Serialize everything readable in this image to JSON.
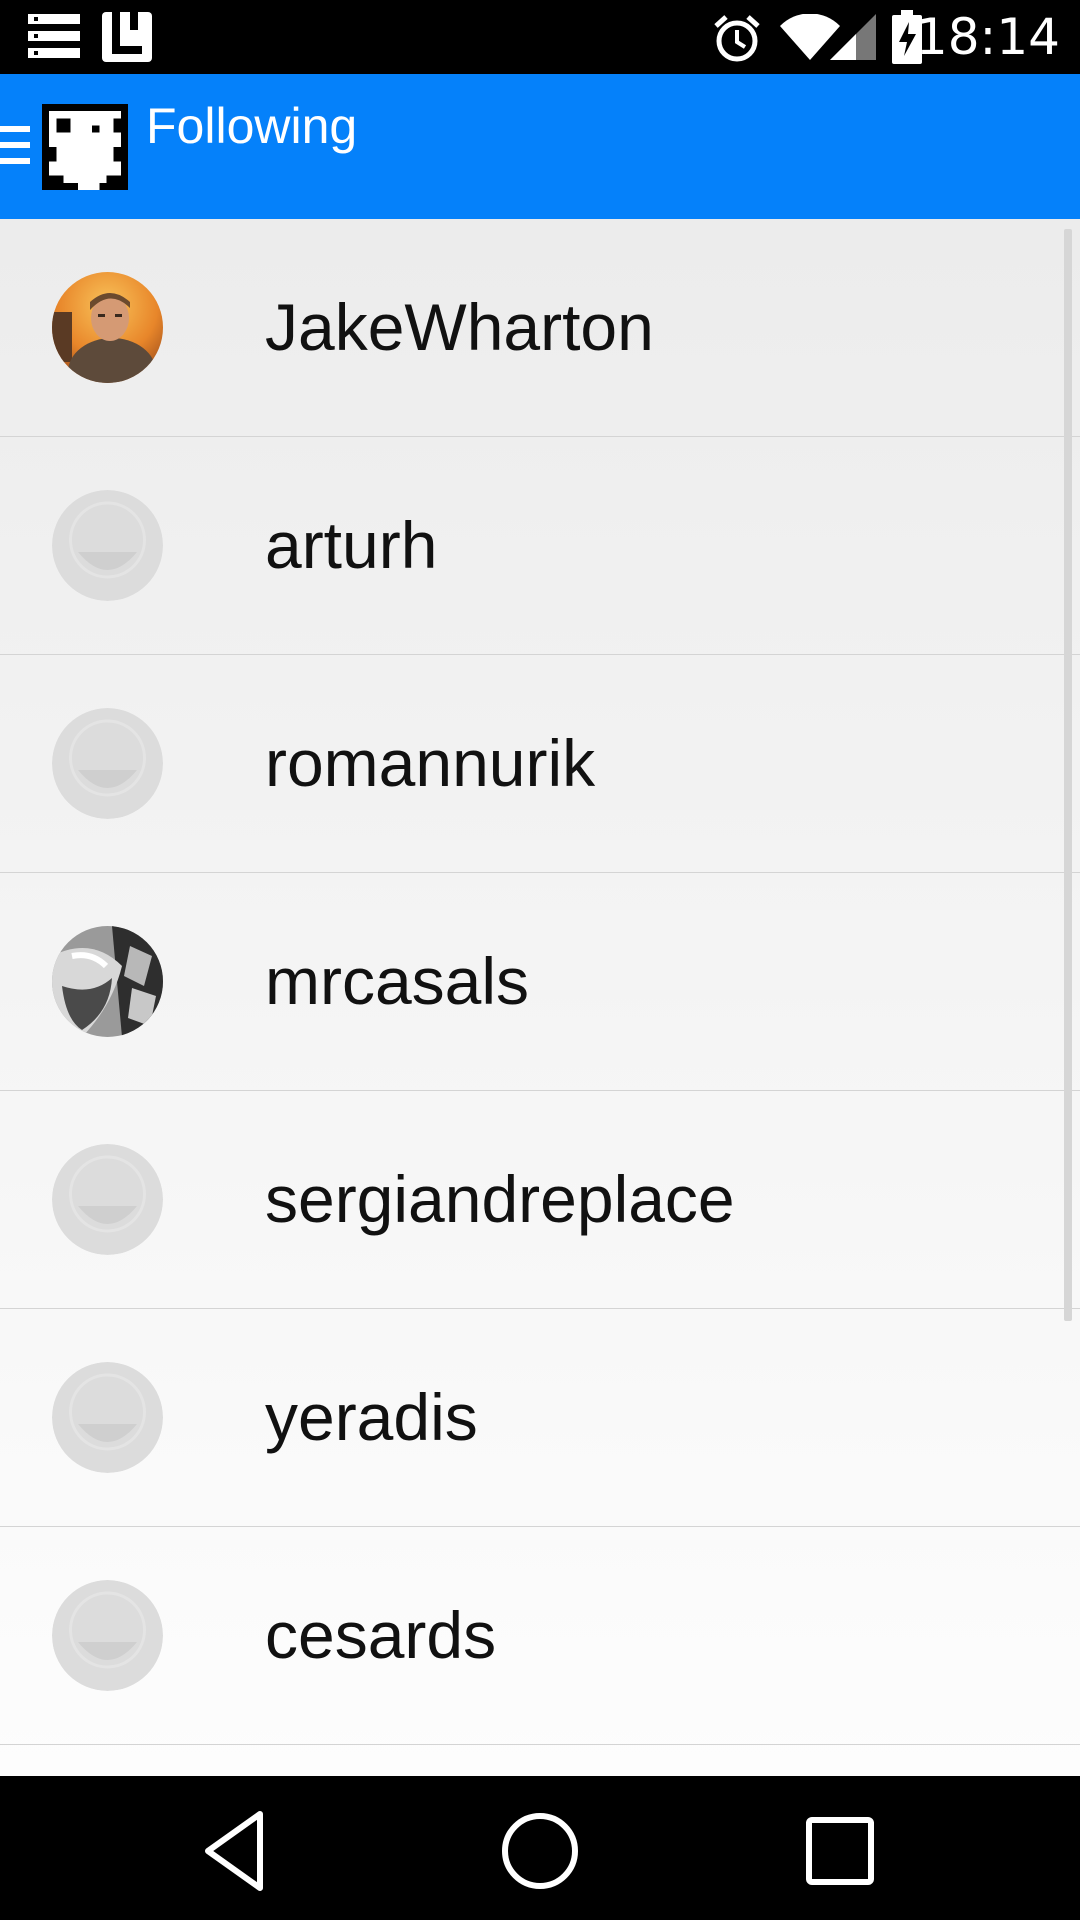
{
  "status_bar": {
    "time": "18:14",
    "icons": [
      "notification-menu-icon",
      "notification-l-icon",
      "alarm-icon",
      "wifi-icon",
      "signal-icon",
      "battery-charging-icon"
    ]
  },
  "app_bar": {
    "title": "Following",
    "menu_icon": "hamburger-menu-icon",
    "logo_icon": "pixel-octocat-logo"
  },
  "following": [
    {
      "username": "JakeWharton",
      "avatar": "photo"
    },
    {
      "username": "arturh",
      "avatar": "placeholder"
    },
    {
      "username": "romannurik",
      "avatar": "placeholder"
    },
    {
      "username": "mrcasals",
      "avatar": "photo"
    },
    {
      "username": "sergiandreplace",
      "avatar": "placeholder"
    },
    {
      "username": "yeradis",
      "avatar": "placeholder"
    },
    {
      "username": "cesards",
      "avatar": "placeholder"
    }
  ],
  "nav_bar": {
    "icons": [
      "back-icon",
      "home-icon",
      "recents-icon"
    ]
  },
  "colors": {
    "app_bar": "#0581fa",
    "status_bar": "#000000",
    "nav_bar": "#000000",
    "divider": "#d4d4d4",
    "placeholder_avatar": "#dcdcdc"
  }
}
